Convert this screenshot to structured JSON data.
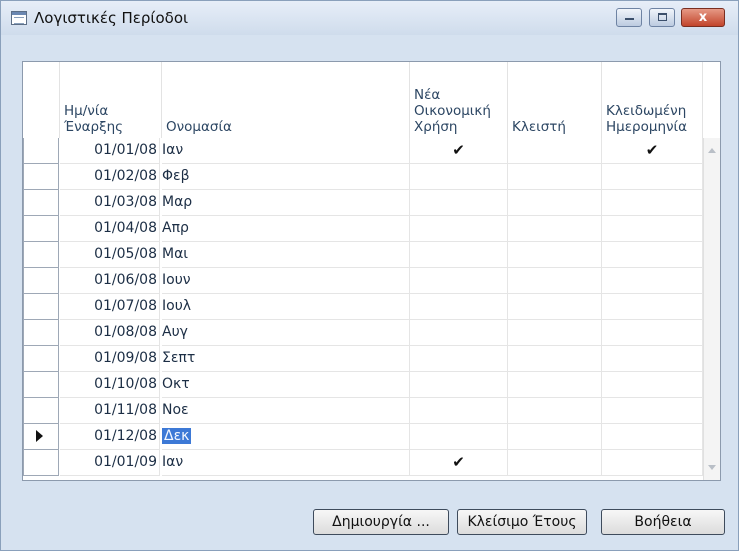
{
  "window": {
    "title": "Λογιστικές Περίοδοι",
    "controls": {
      "close": "x"
    }
  },
  "grid": {
    "columns": {
      "start_date": [
        "Ημ/νία",
        "Έναρξης"
      ],
      "name": [
        "Ονομασία"
      ],
      "new_fiscal_year": [
        "Νέα",
        "Οικονομική",
        "Χρήση"
      ],
      "closed": [
        "Κλειστή"
      ],
      "date_locked": [
        "Κλειδωμένη",
        "Ημερομηνία"
      ]
    },
    "check_glyph": "✔",
    "rows": [
      {
        "date": "01/01/08",
        "name": "Ιαν",
        "new_fy": true,
        "closed": false,
        "locked": true,
        "current": false
      },
      {
        "date": "01/02/08",
        "name": "Φεβ",
        "new_fy": false,
        "closed": false,
        "locked": false,
        "current": false
      },
      {
        "date": "01/03/08",
        "name": "Μαρ",
        "new_fy": false,
        "closed": false,
        "locked": false,
        "current": false
      },
      {
        "date": "01/04/08",
        "name": "Απρ",
        "new_fy": false,
        "closed": false,
        "locked": false,
        "current": false
      },
      {
        "date": "01/05/08",
        "name": "Μαι",
        "new_fy": false,
        "closed": false,
        "locked": false,
        "current": false
      },
      {
        "date": "01/06/08",
        "name": "Ιουν",
        "new_fy": false,
        "closed": false,
        "locked": false,
        "current": false
      },
      {
        "date": "01/07/08",
        "name": "Ιουλ",
        "new_fy": false,
        "closed": false,
        "locked": false,
        "current": false
      },
      {
        "date": "01/08/08",
        "name": "Αυγ",
        "new_fy": false,
        "closed": false,
        "locked": false,
        "current": false
      },
      {
        "date": "01/09/08",
        "name": "Σεπτ",
        "new_fy": false,
        "closed": false,
        "locked": false,
        "current": false
      },
      {
        "date": "01/10/08",
        "name": "Οκτ",
        "new_fy": false,
        "closed": false,
        "locked": false,
        "current": false
      },
      {
        "date": "01/11/08",
        "name": "Νοε",
        "new_fy": false,
        "closed": false,
        "locked": false,
        "current": false
      },
      {
        "date": "01/12/08",
        "name": "Δεκ",
        "new_fy": false,
        "closed": false,
        "locked": false,
        "current": true
      },
      {
        "date": "01/01/09",
        "name": "Ιαν",
        "new_fy": true,
        "closed": false,
        "locked": false,
        "current": false
      }
    ]
  },
  "buttons": {
    "create": "Δημιουργία ...",
    "close_year": "Κλείσιμο Έτους",
    "help": "Βοήθεια"
  },
  "colors": {
    "selection": "#3d79d6",
    "header_text": "#2c4663",
    "close_button": "#c2452b"
  }
}
